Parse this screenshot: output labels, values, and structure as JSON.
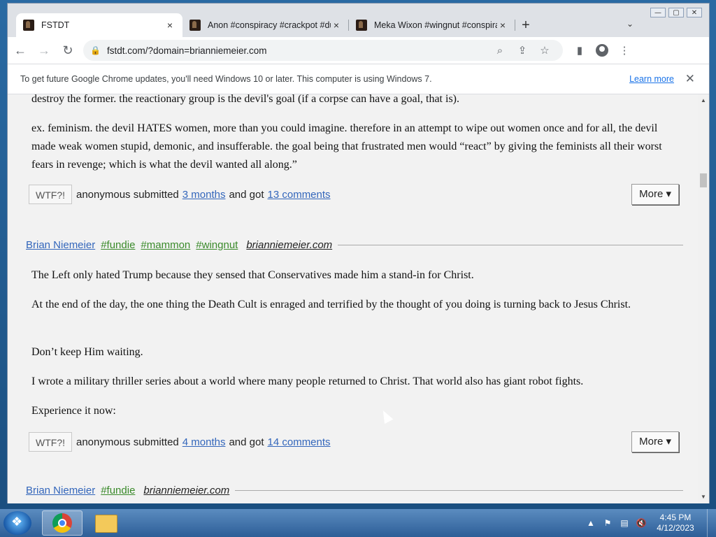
{
  "window": {
    "controls": [
      "—",
      "▢",
      "✕"
    ]
  },
  "tabs": [
    {
      "title": "FSTDT",
      "close": "×"
    },
    {
      "title": "Anon #conspiracy #crackpot #du",
      "close": "×"
    },
    {
      "title": "Meka Wixon #wingnut #conspira",
      "close": "×"
    }
  ],
  "new_tab_label": "+",
  "tab_search_label": "⌄",
  "toolbar": {
    "url": "fstdt.com/?domain=brianniemeier.com"
  },
  "infobar": {
    "message": "To get future Google Chrome updates, you'll need Windows 10 or later. This computer is using Windows 7.",
    "link": "Learn more",
    "close": "✕"
  },
  "posts": [
    {
      "paragraphs": [
        "destroy the former. the reactionary group is the devil's goal (if a corpse can have a goal, that is).",
        "ex. feminism. the devil HATES women, more than you could imagine. therefore in an attempt to wipe out women once and for all, the devil made weak women stupid, demonic, and insufferable. the goal being that frustrated men would “react” by giving the feminists all their worst fears in revenge; which is what the devil wanted all along.”"
      ],
      "wtf": "WTF?!",
      "submitted": "anonymous submitted",
      "age": "3 months",
      "got": "and got",
      "comments": "13 comments",
      "more": "More ▾"
    },
    {
      "author": "Brian Niemeier",
      "tags": [
        "#fundie",
        "#mammon",
        "#wingnut"
      ],
      "domain": "brianniemeier.com",
      "paragraphs": [
        "The Left only hated Trump because they sensed that Conservatives made him a stand-in for Christ.",
        "At the end of the day, the one thing the Death Cult is enraged and terrified by the thought of you doing is turning back to Jesus Christ.",
        "Don’t keep Him waiting.",
        "I wrote a military thriller series about a world where many people returned to Christ. That world also has giant robot fights.",
        "Experience it now:"
      ],
      "wtf": "WTF?!",
      "submitted": "anonymous submitted",
      "age": "4 months",
      "got": "and got",
      "comments": "14 comments",
      "more": "More ▾"
    },
    {
      "author": "Brian Niemeier",
      "tags": [
        "#fundie"
      ],
      "domain": "brianniemeier.com"
    }
  ],
  "taskbar": {
    "time": "4:45 PM",
    "date": "4/12/2023"
  }
}
